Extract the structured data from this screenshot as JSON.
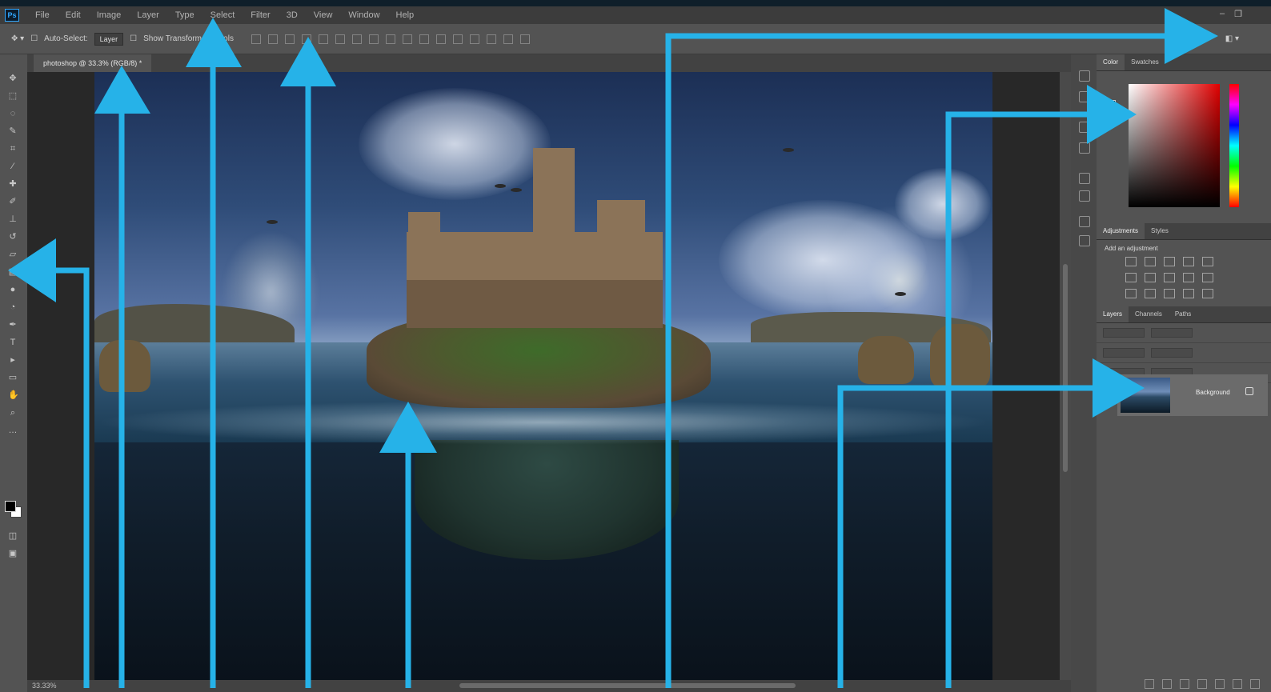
{
  "app": {
    "logo": "Ps",
    "menu": [
      "File",
      "Edit",
      "Image",
      "Layer",
      "Type",
      "Select",
      "Filter",
      "3D",
      "View",
      "Window",
      "Help"
    ]
  },
  "options_bar": {
    "auto_select_label": "Auto-Select:",
    "auto_select_value": "Layer",
    "show_transform_label": "Show Transform Controls"
  },
  "document": {
    "tab_title": "photoshop @ 33.3% (RGB/8) *"
  },
  "status": {
    "text": "33.33%"
  },
  "panels": {
    "color_tabs": [
      "Color",
      "Swatches"
    ],
    "adjustments_tabs": [
      "Adjustments",
      "Styles"
    ],
    "adjustments_label": "Add an adjustment",
    "layers_tabs": [
      "Layers",
      "Channels",
      "Paths"
    ],
    "layer_name": "Background"
  },
  "colors": {
    "annotation_arrow": "#26b2e8",
    "workspace": "#535353"
  },
  "icons": {
    "tools": [
      "move-tool-icon",
      "marquee-tool-icon",
      "lasso-tool-icon",
      "quick-select-tool-icon",
      "crop-tool-icon",
      "eyedropper-tool-icon",
      "healing-brush-tool-icon",
      "brush-tool-icon",
      "clone-stamp-tool-icon",
      "history-brush-tool-icon",
      "eraser-tool-icon",
      "gradient-tool-icon",
      "blur-tool-icon",
      "dodge-tool-icon",
      "pen-tool-icon",
      "type-tool-icon",
      "path-select-tool-icon",
      "shape-tool-icon",
      "hand-tool-icon",
      "zoom-tool-icon"
    ]
  }
}
